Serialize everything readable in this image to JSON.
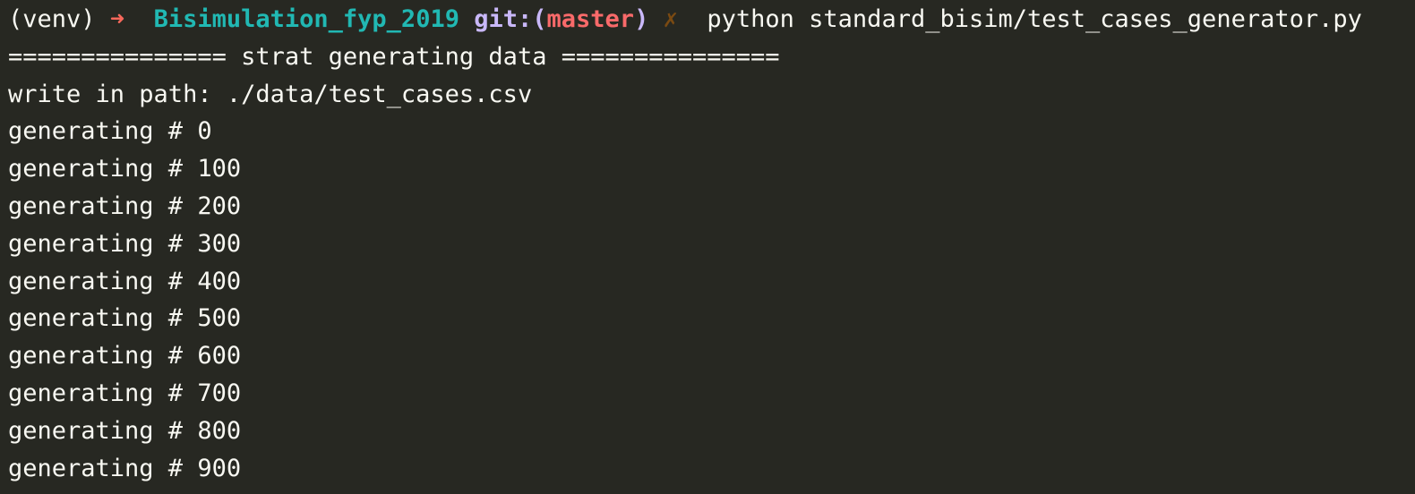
{
  "terminal": {
    "prompt": {
      "venv": "(venv)",
      "arrow": "➜",
      "directory": "Bisimulation_fyp_2019",
      "git_prefix": "git:(",
      "branch": "master",
      "git_suffix": ")",
      "dirty_mark": "✗",
      "command": "python standard_bisim/test_cases_generator.py"
    },
    "output": [
      "=============== strat generating data ===============",
      "write in path: ./data/test_cases.csv",
      "generating # 0",
      "generating # 100",
      "generating # 200",
      "generating # 300",
      "generating # 400",
      "generating # 500",
      "generating # 600",
      "generating # 700",
      "generating # 800",
      "generating # 900"
    ]
  },
  "colors": {
    "background": "#272822",
    "text": "#f8f8f2",
    "arrow": "#f7685b",
    "directory": "#21b8b3",
    "git": "#c9b8f9",
    "branch": "#f96a6a",
    "dirty": "#7a4a12"
  }
}
